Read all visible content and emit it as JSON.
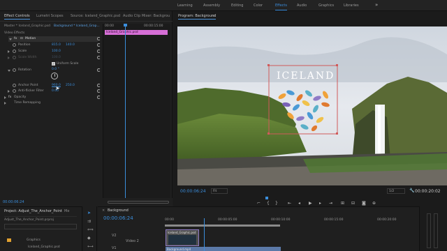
{
  "workspaces": {
    "items": [
      "Learning",
      "Assembly",
      "Editing",
      "Color",
      "Effects",
      "Audio",
      "Graphics",
      "Libraries"
    ],
    "active": "Effects",
    "more": "»"
  },
  "effect_controls": {
    "tabs": [
      "Effect Controls",
      "Lumetri Scopes",
      "Source: Iceland_Graphic.psd",
      "Audio Clip Mixer: Backgrou"
    ],
    "master_label": "Master * Iceland_Graphic.psd",
    "sequence_label": "Background * Iceland_Grap...",
    "section_label": "Video Effects",
    "motion_label": "Motion",
    "properties": [
      {
        "label": "Position",
        "value1": "815.0",
        "value2": "140.0"
      },
      {
        "label": "Scale",
        "value1": "100.0",
        "value2": ""
      },
      {
        "label": "Scale Width",
        "value1": "100.0",
        "value2": ""
      },
      {
        "label": "Uniform Scale",
        "value1": "",
        "value2": ""
      },
      {
        "label": "Rotation",
        "value1": "0.0 °",
        "value2": ""
      },
      {
        "label": "Anchor Point",
        "value1": "960.0",
        "value2": "250.0"
      },
      {
        "label": "Anti-flicker Filter",
        "value1": "0.00",
        "value2": ""
      }
    ],
    "opacity_label": "Opacity",
    "time_remap_label": "Time Remapping",
    "ruler_start": "00:00",
    "ruler_end": "00:00:15:00",
    "clip_bar_label": "Iceland_Graphic.psd",
    "current_time": "00:00:06:24"
  },
  "program_monitor": {
    "title": "Program: Background",
    "menu_glyph": "≡",
    "overlay_text": "ICELAND",
    "timecode": "00:00:06:24",
    "fit": "Fit",
    "quality": "1/2",
    "duration": "00:00:20:02",
    "controls": [
      "mark-in",
      "mark-out",
      "go-to-in",
      "step-back",
      "play",
      "step-forward",
      "go-to-out",
      "insert",
      "overwrite",
      "export-frame",
      "settings"
    ]
  },
  "project": {
    "tabs": [
      "Project: Adjust_The_Anchor_Point",
      "Me"
    ],
    "file": "Adjust_The_Anchor_Point.prproj",
    "items": [
      "Graphics",
      "Iceland_Graphic.psd"
    ]
  },
  "timeline": {
    "tab": "Background",
    "timecode": "00:00:06:24",
    "ruler": [
      "00:00",
      "00:00:05:00",
      "00:00:10:00",
      "00:00:15:00",
      "00:00:20:00"
    ],
    "track_labels": [
      "V2",
      "Video 2",
      "V1"
    ],
    "clip_top": "Iceland_Graphic.psd",
    "clip_bottom": "Background.mp4"
  },
  "colors": {
    "accent": "#3b8edc",
    "clip_pink": "#d66fd6",
    "clip_purple": "#8f7bc7",
    "clip_teal": "#5bb0c8"
  }
}
